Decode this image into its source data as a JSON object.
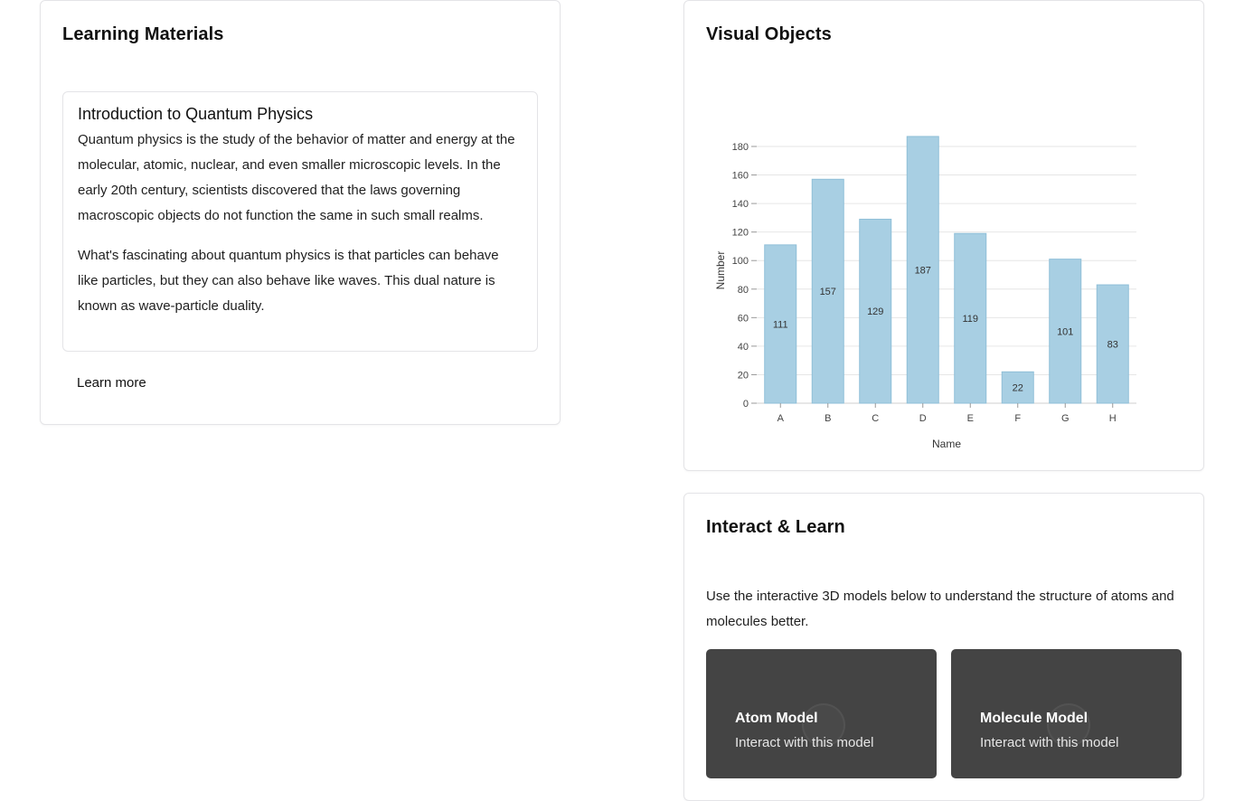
{
  "learning": {
    "title": "Learning Materials",
    "lesson": {
      "title": "Introduction to Quantum Physics",
      "paragraphs": [
        "Quantum physics is the study of the behavior of matter and energy at the molecular, atomic, nuclear, and even smaller microscopic levels. In the early 20th century, scientists discovered that the laws governing macroscopic objects do not function the same in such small realms.",
        "What's fascinating about quantum physics is that particles can behave like particles, but they can also behave like waves. This dual nature is known as wave-particle duality."
      ]
    },
    "learn_more": "Learn more"
  },
  "visual": {
    "title": "Visual Objects"
  },
  "chart_data": {
    "type": "bar",
    "categories": [
      "A",
      "B",
      "C",
      "D",
      "E",
      "F",
      "G",
      "H"
    ],
    "values": [
      111,
      157,
      129,
      187,
      119,
      22,
      101,
      83
    ],
    "title": "",
    "xlabel": "Name",
    "ylabel": "Number",
    "ylim": [
      0,
      180
    ],
    "yticks": [
      0,
      20,
      40,
      60,
      80,
      100,
      120,
      140,
      160,
      180
    ],
    "grid": true,
    "bar_color": "#a8cfe3",
    "bar_border_color": "#8fbfd8"
  },
  "interact": {
    "title": "Interact & Learn",
    "description": "Use the interactive 3D models below to understand the structure of atoms and molecules better.",
    "models": [
      {
        "title": "Atom Model",
        "subtitle": "Interact with this model"
      },
      {
        "title": "Molecule Model",
        "subtitle": "Interact with this model"
      }
    ]
  }
}
